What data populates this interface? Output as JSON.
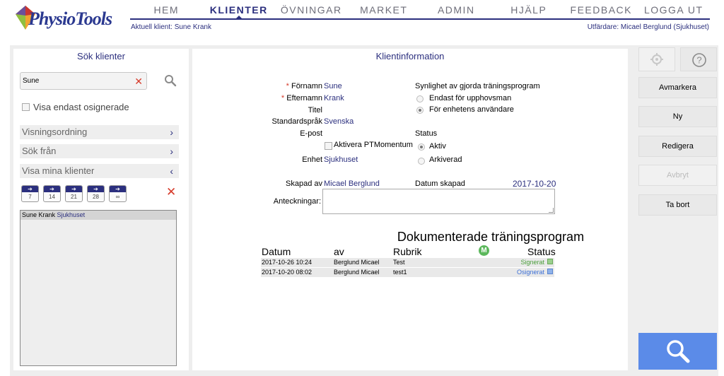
{
  "brand": {
    "logo_text": "PhysioTools"
  },
  "nav": [
    {
      "label": "HEM",
      "active": false
    },
    {
      "label": "KLIENTER",
      "active": true
    },
    {
      "label": "ÖVNINGAR",
      "active": false
    },
    {
      "label": "MARKET",
      "active": false
    },
    {
      "label": "ADMIN",
      "active": false
    },
    {
      "label": "HJÄLP",
      "active": false
    },
    {
      "label": "FEEDBACK",
      "active": false
    },
    {
      "label": "LOGGA UT",
      "active": false
    }
  ],
  "header": {
    "current_client": "Aktuell klient: Sune Krank",
    "issuer": "Utfärdare: Micael Berglund (Sjukhuset)"
  },
  "search_panel": {
    "title": "Sök klienter",
    "search_value": "Sune",
    "only_unsigned_label": "Visa endast osignerade",
    "sort_label": "Visningsordning",
    "search_from_label": "Sök från",
    "show_my_clients_label": "Visa mina klienter",
    "day_buttons": [
      "7",
      "14",
      "21",
      "28",
      "∞"
    ],
    "results": [
      {
        "name": "Sune Krank",
        "unit": "Sjukhuset"
      }
    ]
  },
  "client_info": {
    "title": "Klientinformation",
    "first_name_label": "Förnamn",
    "first_name": "Sune",
    "last_name_label": "Efternamn",
    "last_name": "Krank",
    "title_label": "Titel",
    "title_value": "",
    "language_label": "Standardspråk",
    "language": "Svenska",
    "email_label": "E-post",
    "email": "",
    "activate_label": "Aktivera PTMomentum",
    "unit_label": "Enhet",
    "unit": "Sjukhuset",
    "visibility_title": "Synlighet av gjorda träningsprogram",
    "visibility_options": [
      "Endast för upphovsman",
      "För enhetens användare"
    ],
    "status_title": "Status",
    "status_options": [
      "Aktiv",
      "Arkiverad"
    ],
    "created_by_label": "Skapad av",
    "created_by": "Micael Berglund",
    "date_created_label": "Datum skapad",
    "date_created": "2017-10-20",
    "notes_label": "Anteckningar:"
  },
  "programs": {
    "title": "Dokumenterade träningsprogram",
    "headers": {
      "date": "Datum",
      "by": "av",
      "heading": "Rubrik",
      "status": "Status"
    },
    "m_badge": "M",
    "rows": [
      {
        "date": "2017-10-26 10:24",
        "by": "Berglund Micael",
        "heading": "Test",
        "status": "Signerat",
        "status_color": "#4a9e3a",
        "marker_color": "#9bd08e"
      },
      {
        "date": "2017-10-20 08:02",
        "by": "Berglund Micael",
        "heading": "test1",
        "status": "Osignerat",
        "status_color": "#3b6fd6",
        "marker_color": "#8fb2ea"
      }
    ]
  },
  "actions": {
    "deselect": "Avmarkera",
    "new": "Ny",
    "edit": "Redigera",
    "cancel": "Avbryt",
    "delete": "Ta bort"
  },
  "icons": {
    "settings": "gear-icon",
    "help": "help-icon",
    "search": "search-icon"
  }
}
